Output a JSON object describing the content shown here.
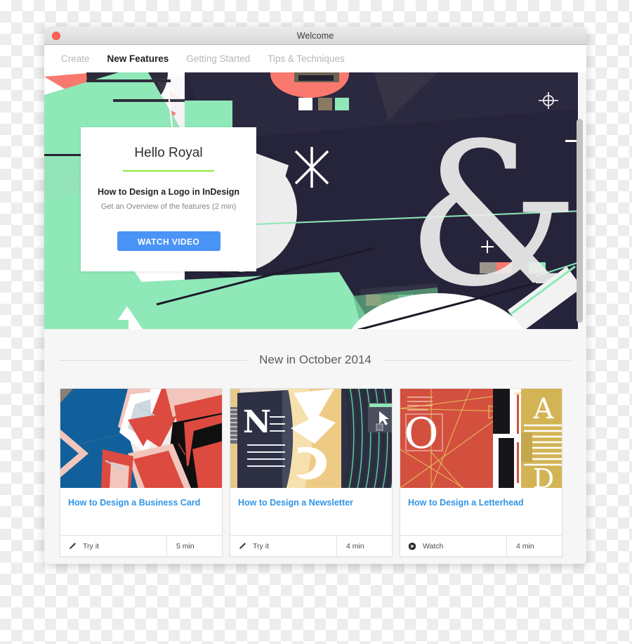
{
  "window": {
    "title": "Welcome",
    "close_button_label": "",
    "close_color": "#fb5f52"
  },
  "tabs": [
    {
      "label": "Create",
      "active": false
    },
    {
      "label": "New Features",
      "active": true
    },
    {
      "label": "Getting Started",
      "active": false
    },
    {
      "label": "Tips & Techniques",
      "active": false
    }
  ],
  "hero": {
    "greeting": "Hello Royal",
    "accent_color": "#8ee83e",
    "subtitle": "How to Design a Logo in InDesign",
    "description": "Get an Overview of the features (2 min)",
    "button_label": "WATCH VIDEO",
    "button_color": "#4a93f7",
    "artwork_colors": {
      "background": "#262433",
      "mint": "#8fe8b8",
      "green": "#5fb383",
      "coral": "#f9796e",
      "white": "#ffffff",
      "tan": "#8a7a63"
    }
  },
  "section": {
    "heading": "New in October 2014"
  },
  "cards": [
    {
      "title": "How to Design a Business Card",
      "action_icon": "pencil-icon",
      "action_label": "Try it",
      "duration": "5 min"
    },
    {
      "title": "How to Design a Newsletter",
      "action_icon": "pencil-icon",
      "action_label": "Try it",
      "duration": "4 min"
    },
    {
      "title": "How to Design a Letterhead",
      "action_icon": "play-circle-icon",
      "action_label": "Watch",
      "duration": "4 min"
    }
  ],
  "link_color": "#2f95e8"
}
